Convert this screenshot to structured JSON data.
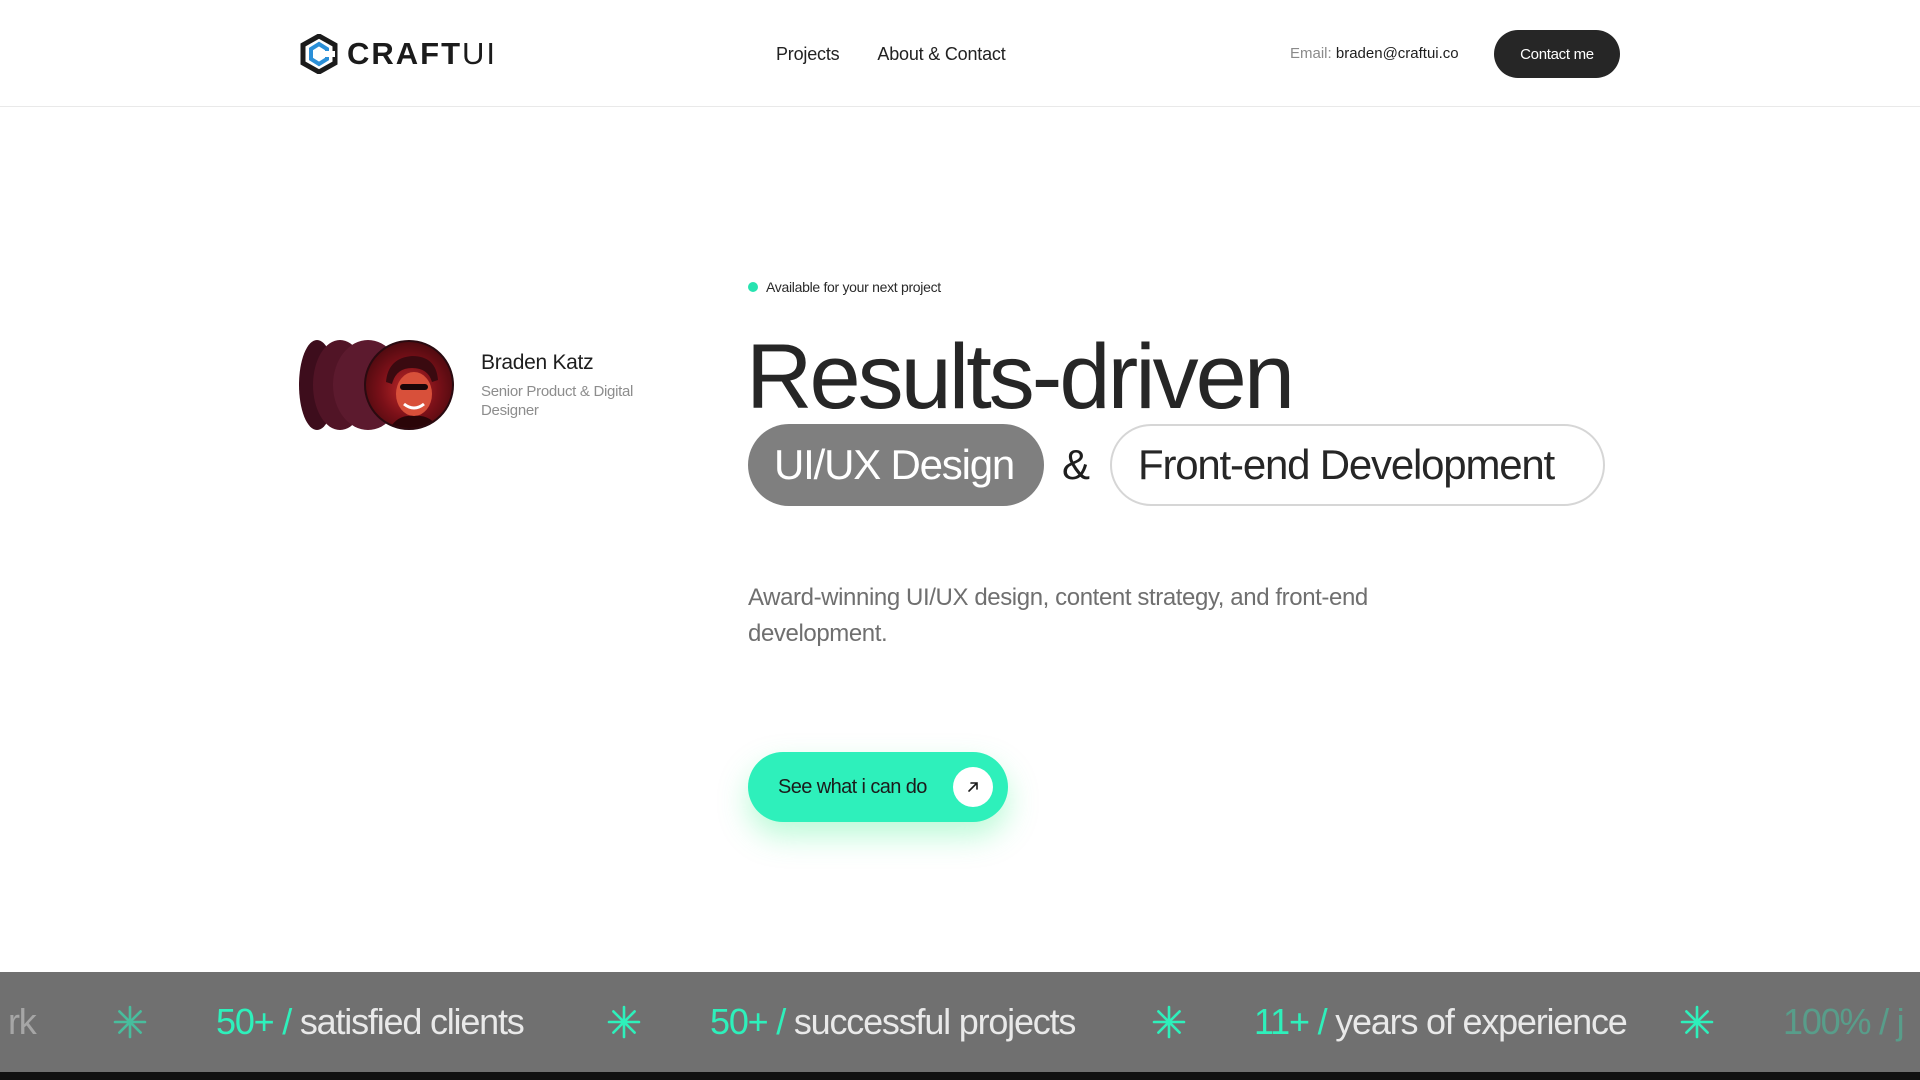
{
  "header": {
    "logo_text_bold": "CRAFT",
    "logo_text_light": "UI",
    "nav": [
      {
        "label": "Projects"
      },
      {
        "label": "About & Contact"
      }
    ],
    "email_label": "Email:",
    "email_value": "braden@craftui.co",
    "contact_button": "Contact me"
  },
  "profile": {
    "name": "Braden Katz",
    "role": "Senior Product & Digital Designer"
  },
  "hero": {
    "availability": "Available for your next project",
    "headline": "Results-driven",
    "pill_primary": "UI/UX Design",
    "ampersand": "&",
    "pill_secondary": "Front-end Development",
    "description": "Award-winning UI/UX design, content strategy, and front-end development.",
    "cta_label": "See what i can do"
  },
  "stats": {
    "items": [
      {
        "num": "",
        "text": "rk"
      },
      {
        "num": "50+ /",
        "text": " satisfied clients"
      },
      {
        "num": "50+ /",
        "text": " successful projects"
      },
      {
        "num": "11+ /",
        "text": " years of experience"
      },
      {
        "num": "100% / j",
        "text": ""
      }
    ]
  },
  "colors": {
    "accent": "#2ef0bb",
    "dark": "#262626",
    "marquee_bg": "#707070"
  }
}
